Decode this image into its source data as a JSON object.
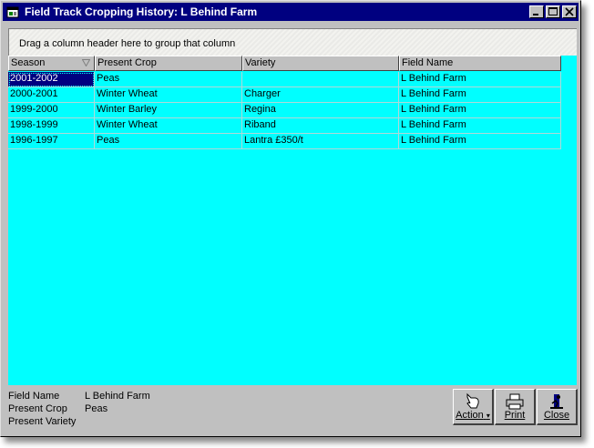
{
  "window": {
    "title": "Field Track Cropping History: L Behind Farm"
  },
  "grid": {
    "group_hint": "Drag a column header here to group that column",
    "columns": [
      "Season",
      "Present Crop",
      "Variety",
      "Field Name"
    ],
    "rows": [
      [
        "2001-2002",
        "Peas",
        "",
        "L Behind Farm"
      ],
      [
        "2000-2001",
        "Winter Wheat",
        "Charger",
        "L Behind Farm"
      ],
      [
        "1999-2000",
        "Winter Barley",
        "Regina",
        "L Behind Farm"
      ],
      [
        "1998-1999",
        "Winter Wheat",
        "Riband",
        "L Behind Farm"
      ],
      [
        "1996-1997",
        "Peas",
        "Lantra £350/t",
        "L Behind Farm"
      ]
    ],
    "background_color": "#00ffff",
    "selected_color": "#000080"
  },
  "details": {
    "field_name_label": "Field Name",
    "field_name_value": "L Behind Farm",
    "present_crop_label": "Present Crop",
    "present_crop_value": "Peas",
    "present_variety_label": "Present Variety",
    "present_variety_value": ""
  },
  "buttons": {
    "action": "Action",
    "print": "Print",
    "close": "Close"
  },
  "icons": {
    "title": "app-icon",
    "sort": "sort-triangle-icon",
    "action": "hand-pointer-icon",
    "print": "printer-icon",
    "close": "exit-door-icon"
  }
}
